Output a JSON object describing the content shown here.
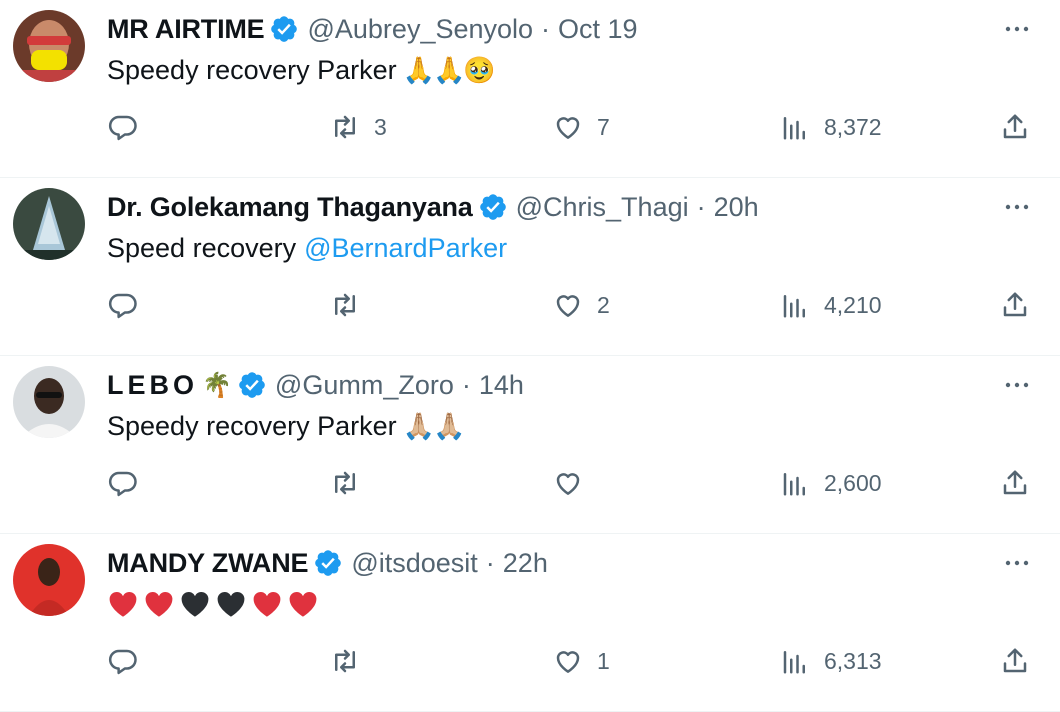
{
  "colors": {
    "text": "#0f1419",
    "secondary": "#536471",
    "accent": "#1d9bf0",
    "verified": "#1d9bf0",
    "divider": "#eff3f4",
    "heart_red": "#e0323e",
    "heart_black": "#2b2f33"
  },
  "icons": {
    "verified": "verified-badge-icon",
    "more": "more-horizontal-icon",
    "reply": "reply-bubble-icon",
    "retweet": "retweet-icon",
    "like": "heart-outline-icon",
    "views": "analytics-bars-icon",
    "share": "share-upload-icon"
  },
  "tweets": [
    {
      "name": "MR AIRTIME",
      "handle": "@Aubrey_Senyolo",
      "separator": "·",
      "time": "Oct 19",
      "text": "Speedy recovery Parker",
      "emoji": "🙏🙏🥹",
      "replies": "",
      "retweets": "3",
      "likes": "7",
      "views": "8,372"
    },
    {
      "name": "Dr. Golekamang Thaganyana",
      "handle": "@Chris_Thagi",
      "separator": "·",
      "time": "20h",
      "text": "Speed recovery",
      "mention": "@BernardParker",
      "replies": "",
      "retweets": "",
      "likes": "2",
      "views": "4,210"
    },
    {
      "name": "LEBO",
      "name_emoji": "🌴",
      "handle": "@Gumm_Zoro",
      "separator": "·",
      "time": "14h",
      "text": "Speedy recovery Parker",
      "emoji": "🙏🏼🙏🏼",
      "replies": "",
      "retweets": "",
      "likes": "",
      "views": "2,600"
    },
    {
      "name": "MANDY ZWANE",
      "handle": "@itsdoesit",
      "separator": "·",
      "time": "22h",
      "hearts": [
        "red",
        "red",
        "black",
        "black",
        "red",
        "red"
      ],
      "replies": "",
      "retweets": "",
      "likes": "1",
      "views": "6,313"
    }
  ]
}
